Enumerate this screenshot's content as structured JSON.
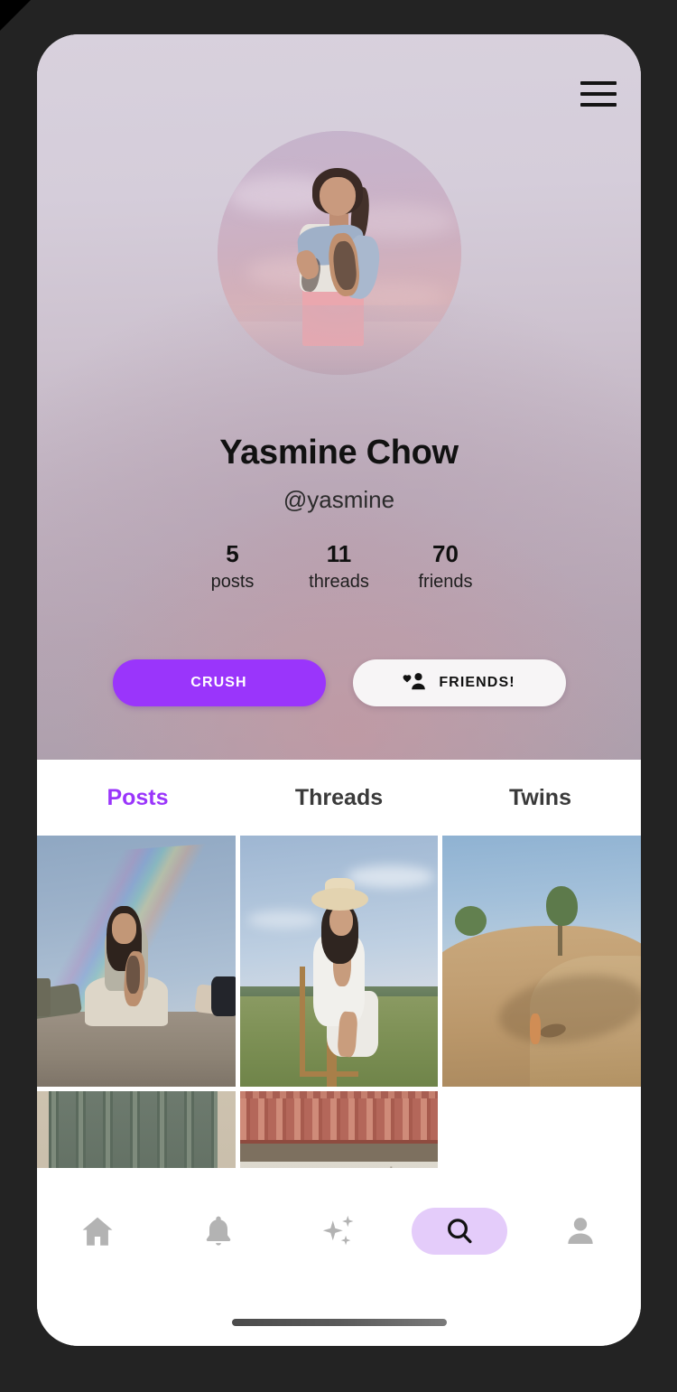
{
  "device": {
    "home_indicator": "home-indicator"
  },
  "header": {
    "menu_icon": "hamburger-menu-icon",
    "avatar_alt": "profile-photo-woman-pink-sky",
    "display_name": "Yasmine Chow",
    "handle": "@yasmine",
    "stats": [
      {
        "value": "5",
        "label": "posts"
      },
      {
        "value": "11",
        "label": "threads"
      },
      {
        "value": "70",
        "label": "friends"
      }
    ],
    "actions": {
      "crush_label": "CRUSH",
      "friends_label": "FRIENDS!",
      "friends_icon": "people-heart-icon"
    },
    "colors": {
      "accent_purple": "#9a35fb",
      "header_top": "#d8d1dd",
      "header_bottom": "#ad9fac"
    }
  },
  "tabs": {
    "items": [
      {
        "label": "Posts",
        "active": true
      },
      {
        "label": "Threads",
        "active": false
      },
      {
        "label": "Twins",
        "active": false
      }
    ],
    "active_color": "#9a35fb",
    "inactive_color": "#3a3a3a"
  },
  "grid": {
    "photos": [
      {
        "id": "photo-1",
        "alt": "woman-sitting-on-hill-with-rainbow"
      },
      {
        "id": "photo-2",
        "alt": "woman-in-white-dress-on-chair-in-field"
      },
      {
        "id": "photo-3",
        "alt": "sand-dune-with-dog-and-trees"
      },
      {
        "id": "photo-4",
        "alt": "green-ornate-iron-gate"
      },
      {
        "id": "photo-5",
        "alt": "building-with-terracotta-roof-tiles"
      }
    ]
  },
  "bottom_nav": {
    "items": [
      {
        "id": "nav-home",
        "icon": "home-icon",
        "active": false
      },
      {
        "id": "nav-alerts",
        "icon": "bell-icon",
        "active": false
      },
      {
        "id": "nav-sparkle",
        "icon": "sparkles-icon",
        "active": false
      },
      {
        "id": "nav-search",
        "icon": "search-icon",
        "active": true
      },
      {
        "id": "nav-profile",
        "icon": "person-icon",
        "active": false
      }
    ],
    "active_pill_color": "#e4ccfa",
    "inactive_color": "#b3b3b3"
  }
}
